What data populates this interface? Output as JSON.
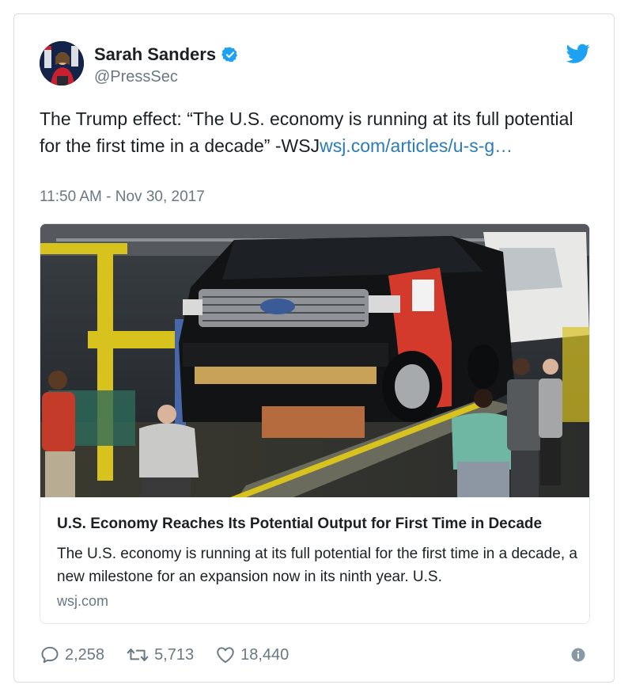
{
  "user": {
    "name": "Sarah Sanders",
    "handle": "@PressSec",
    "verified_icon": "verified-badge-icon"
  },
  "tweet": {
    "text_before_link": "The Trump effect: “The U.S. economy is running at its full potential for the first time in a decade” -WSJ",
    "link_text": "wsj.com/articles/u-s-g…",
    "timestamp": "11:50 AM - Nov 30, 2017"
  },
  "card": {
    "title": "U.S. Economy Reaches Its Potential Output for First Time in Decade",
    "description": "The U.S. economy is running at its full potential for the first time in a decade, a new milestone for an expansion now in its ninth year. U.S.",
    "domain": "wsj.com"
  },
  "actions": {
    "replies": "2,258",
    "retweets": "5,713",
    "likes": "18,440"
  },
  "colors": {
    "twitter_blue": "#1da1f2",
    "link_blue": "#2b7bb9",
    "muted_gray": "#697882",
    "text": "#1c2022"
  }
}
